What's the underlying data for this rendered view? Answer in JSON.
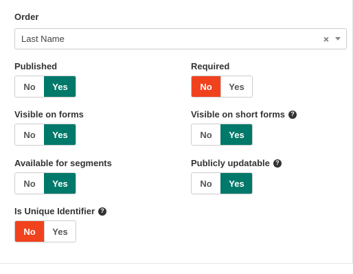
{
  "order": {
    "label": "Order",
    "select_value": "Last Name",
    "clear_glyph": "×"
  },
  "help_glyph": "?",
  "fields": {
    "published": {
      "label": "Published",
      "no": "No",
      "yes": "Yes",
      "selected": "yes"
    },
    "required": {
      "label": "Required",
      "no": "No",
      "yes": "Yes",
      "selected": "no"
    },
    "visible_on_forms": {
      "label": "Visible on forms",
      "no": "No",
      "yes": "Yes",
      "selected": "yes"
    },
    "visible_on_short_forms": {
      "label": "Visible on short forms",
      "no": "No",
      "yes": "Yes",
      "selected": "yes",
      "help_icon": "question-circle-icon"
    },
    "available_for_segments": {
      "label": "Available for segments",
      "no": "No",
      "yes": "Yes",
      "selected": "yes"
    },
    "publicly_updatable": {
      "label": "Publicly updatable",
      "no": "No",
      "yes": "Yes",
      "selected": "yes",
      "help_icon": "question-circle-icon"
    },
    "is_unique_identifier": {
      "label": "Is Unique Identifier",
      "no": "No",
      "yes": "Yes",
      "selected": "no",
      "help_icon": "question-circle-icon"
    }
  },
  "colors": {
    "yes_active": "#00796b",
    "no_active": "#f1421e"
  }
}
